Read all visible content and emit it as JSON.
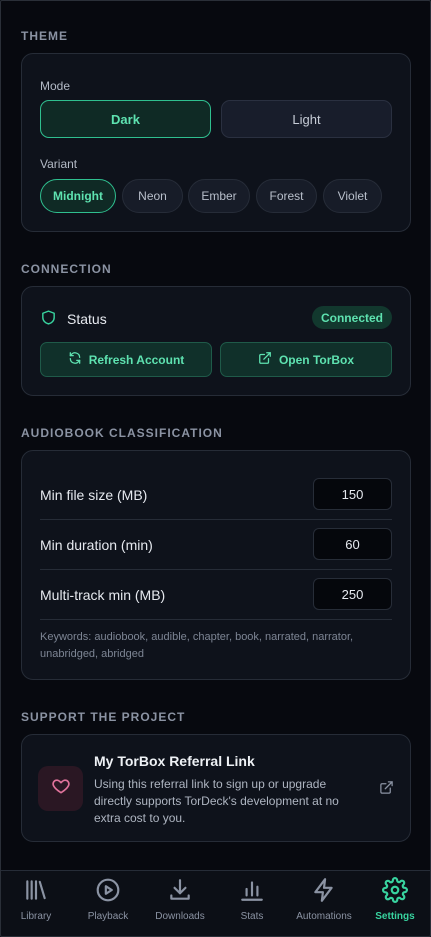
{
  "theme": {
    "title": "THEME",
    "mode_label": "Mode",
    "modes": [
      {
        "label": "Dark",
        "active": true
      },
      {
        "label": "Light",
        "active": false
      }
    ],
    "variant_label": "Variant",
    "variants": [
      {
        "label": "Midnight",
        "active": true
      },
      {
        "label": "Neon",
        "active": false
      },
      {
        "label": "Ember",
        "active": false
      },
      {
        "label": "Forest",
        "active": false
      },
      {
        "label": "Violet",
        "active": false
      }
    ]
  },
  "connection": {
    "title": "CONNECTION",
    "status_icon": "shield-icon",
    "status_label": "Status",
    "status_value": "Connected",
    "refresh_label": "Refresh Account",
    "refresh_icon": "refresh-icon",
    "open_label": "Open TorBox",
    "open_icon": "external-link-icon"
  },
  "audiobook": {
    "title": "AUDIOBOOK CLASSIFICATION",
    "rows": [
      {
        "label": "Min file size (MB)",
        "value": "150"
      },
      {
        "label": "Min duration (min)",
        "value": "60"
      },
      {
        "label": "Multi-track min (MB)",
        "value": "250"
      }
    ],
    "keywords": "Keywords: audiobook, audible, chapter, book, narrated, narrator, unabridged, abridged"
  },
  "support": {
    "title": "SUPPORT THE PROJECT",
    "icon": "heart-icon",
    "referral_title": "My TorBox Referral Link",
    "referral_desc": "Using this referral link to sign up or upgrade directly supports TorDeck's development at no extra cost to you."
  },
  "tabs": [
    {
      "label": "Library",
      "icon": "library-icon",
      "active": false
    },
    {
      "label": "Playback",
      "icon": "play-icon",
      "active": false
    },
    {
      "label": "Downloads",
      "icon": "download-icon",
      "active": false
    },
    {
      "label": "Stats",
      "icon": "stats-icon",
      "active": false
    },
    {
      "label": "Automations",
      "icon": "lightning-icon",
      "active": false
    },
    {
      "label": "Settings",
      "icon": "gear-icon",
      "active": true
    }
  ],
  "colors": {
    "accent": "#38d39f",
    "background": "#07090f",
    "card": "#0e121b",
    "heart": "#e0739b"
  }
}
